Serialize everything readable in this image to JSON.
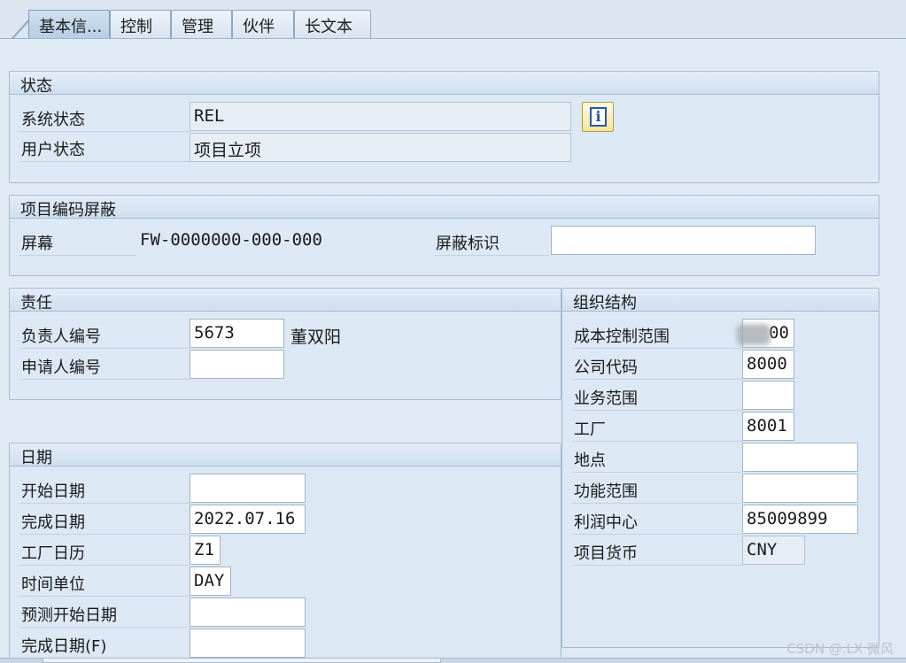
{
  "tabs": [
    {
      "label": "基本信..."
    },
    {
      "label": "控制"
    },
    {
      "label": "管理"
    },
    {
      "label": "伙伴"
    },
    {
      "label": "长文本"
    }
  ],
  "status_group": {
    "title": "状态",
    "system_status_label": "系统状态",
    "system_status_value": "REL",
    "user_status_label": "用户状态",
    "user_status_value": "项目立项",
    "info_icon": "info-icon"
  },
  "mask_group": {
    "title": "项目编码屏蔽",
    "screen_label": "屏幕",
    "screen_value": "FW-0000000-000-000",
    "mask_id_label": "屏蔽标识",
    "mask_id_value": ""
  },
  "responsibility_group": {
    "title": "责任",
    "responsible_label": "负责人编号",
    "responsible_value": "5673",
    "responsible_name": "董双阳",
    "applicant_label": "申请人编号",
    "applicant_value": ""
  },
  "dates_group": {
    "title": "日期",
    "start_label": "开始日期",
    "start_value": "",
    "finish_label": "完成日期",
    "finish_value": "2022.07.16",
    "calendar_label": "工厂日历",
    "calendar_value": "Z1",
    "time_unit_label": "时间单位",
    "time_unit_value": "DAY",
    "fc_start_label": "预测开始日期",
    "fc_start_value": "",
    "fc_finish_label": "完成日期(F)",
    "fc_finish_value": ""
  },
  "org_group": {
    "title": "组织结构",
    "controlling_area_label": "成本控制范围",
    "controlling_area_value": "00",
    "company_code_label": "公司代码",
    "company_code_value": "8000",
    "business_area_label": "业务范围",
    "business_area_value": "",
    "plant_label": "工厂",
    "plant_value": "8001",
    "location_label": "地点",
    "location_value": "",
    "functional_area_label": "功能范围",
    "functional_area_value": "",
    "profit_center_label": "利润中心",
    "profit_center_value": "85009899",
    "currency_label": "项目货币",
    "currency_value": "CNY"
  },
  "watermark": "CSDN @.LX 微风",
  "colors": {
    "background": "#dfeaf5",
    "group_header": "#cfdff0",
    "border": "#a6bacf",
    "info_button": "#f6e49a"
  }
}
